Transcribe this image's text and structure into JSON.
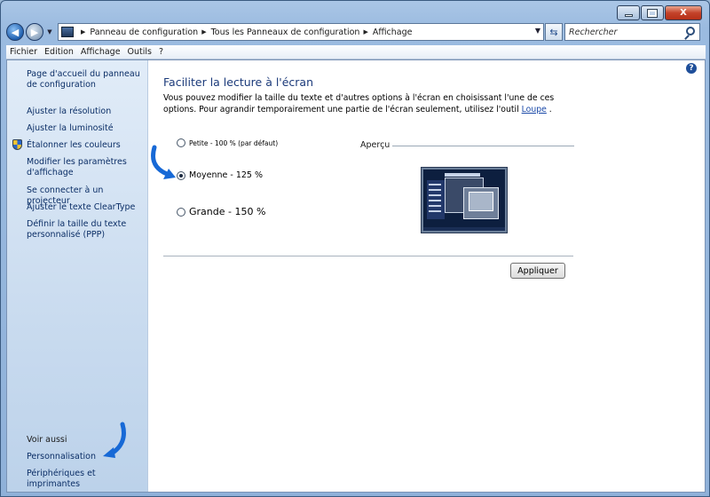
{
  "window": {
    "caption_close": "X"
  },
  "address": {
    "crumbs": [
      "Panneau de configuration",
      "Tous les Panneaux de configuration",
      "Affichage"
    ],
    "search_placeholder": "Rechercher"
  },
  "menu": [
    "Fichier",
    "Edition",
    "Affichage",
    "Outils",
    "?"
  ],
  "sidebar": {
    "top_links": [
      "Page d'accueil du panneau de configuration",
      "Ajuster la résolution",
      "Ajuster la luminosité",
      "Étalonner les couleurs",
      "Modifier les paramètres d'affichage",
      "Se connecter à un projecteur",
      "Ajuster le texte ClearType",
      "Définir la taille du texte personnalisé (PPP)"
    ],
    "see_also": "Voir aussi",
    "bottom_links": [
      "Personnalisation",
      "Périphériques et imprimantes"
    ]
  },
  "main": {
    "title": "Faciliter la lecture à l'écran",
    "description_1": "Vous pouvez modifier la taille du texte et d'autres options à l'écran en choisissant l'une de ces options. Pour agrandir temporairement une partie de l'écran seulement, utilisez l'outil ",
    "description_link": "Loupe",
    "description_2": " .",
    "options": [
      {
        "label": "Petite - 100 % (par défaut)",
        "checked": false
      },
      {
        "label": "Moyenne - 125 %",
        "checked": true
      },
      {
        "label": "Grande - 150 %",
        "checked": false
      }
    ],
    "preview_label": "Aperçu",
    "apply_button": "Appliquer"
  },
  "colors": {
    "link": "#0b2e66",
    "title": "#1b3a7a",
    "arrow": "#1769d6"
  }
}
